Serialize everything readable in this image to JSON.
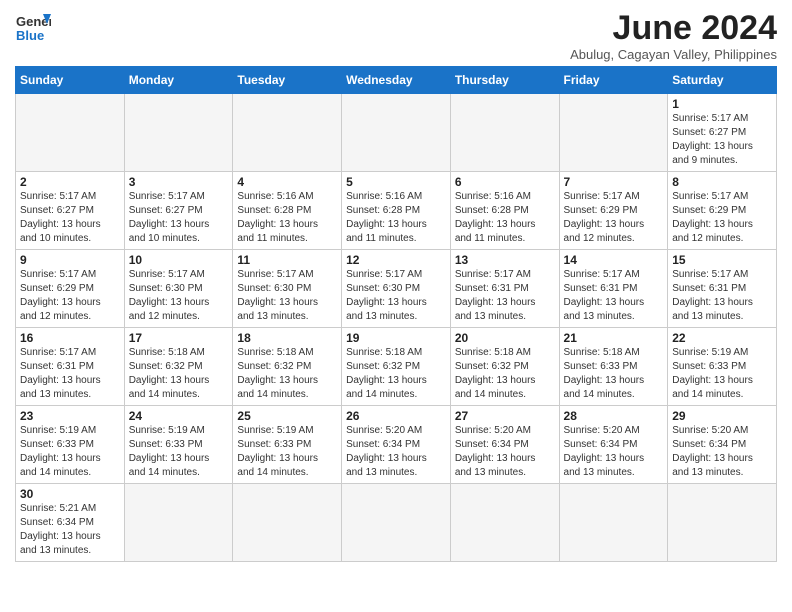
{
  "header": {
    "logo_line1": "General",
    "logo_line2": "Blue",
    "month_year": "June 2024",
    "location": "Abulug, Cagayan Valley, Philippines"
  },
  "weekdays": [
    "Sunday",
    "Monday",
    "Tuesday",
    "Wednesday",
    "Thursday",
    "Friday",
    "Saturday"
  ],
  "weeks": [
    [
      {
        "day": "",
        "info": ""
      },
      {
        "day": "",
        "info": ""
      },
      {
        "day": "",
        "info": ""
      },
      {
        "day": "",
        "info": ""
      },
      {
        "day": "",
        "info": ""
      },
      {
        "day": "",
        "info": ""
      },
      {
        "day": "1",
        "info": "Sunrise: 5:17 AM\nSunset: 6:27 PM\nDaylight: 13 hours\nand 9 minutes."
      }
    ],
    [
      {
        "day": "2",
        "info": "Sunrise: 5:17 AM\nSunset: 6:27 PM\nDaylight: 13 hours\nand 10 minutes."
      },
      {
        "day": "3",
        "info": "Sunrise: 5:17 AM\nSunset: 6:27 PM\nDaylight: 13 hours\nand 10 minutes."
      },
      {
        "day": "4",
        "info": "Sunrise: 5:16 AM\nSunset: 6:28 PM\nDaylight: 13 hours\nand 11 minutes."
      },
      {
        "day": "5",
        "info": "Sunrise: 5:16 AM\nSunset: 6:28 PM\nDaylight: 13 hours\nand 11 minutes."
      },
      {
        "day": "6",
        "info": "Sunrise: 5:16 AM\nSunset: 6:28 PM\nDaylight: 13 hours\nand 11 minutes."
      },
      {
        "day": "7",
        "info": "Sunrise: 5:17 AM\nSunset: 6:29 PM\nDaylight: 13 hours\nand 12 minutes."
      },
      {
        "day": "8",
        "info": "Sunrise: 5:17 AM\nSunset: 6:29 PM\nDaylight: 13 hours\nand 12 minutes."
      }
    ],
    [
      {
        "day": "9",
        "info": "Sunrise: 5:17 AM\nSunset: 6:29 PM\nDaylight: 13 hours\nand 12 minutes."
      },
      {
        "day": "10",
        "info": "Sunrise: 5:17 AM\nSunset: 6:30 PM\nDaylight: 13 hours\nand 12 minutes."
      },
      {
        "day": "11",
        "info": "Sunrise: 5:17 AM\nSunset: 6:30 PM\nDaylight: 13 hours\nand 13 minutes."
      },
      {
        "day": "12",
        "info": "Sunrise: 5:17 AM\nSunset: 6:30 PM\nDaylight: 13 hours\nand 13 minutes."
      },
      {
        "day": "13",
        "info": "Sunrise: 5:17 AM\nSunset: 6:31 PM\nDaylight: 13 hours\nand 13 minutes."
      },
      {
        "day": "14",
        "info": "Sunrise: 5:17 AM\nSunset: 6:31 PM\nDaylight: 13 hours\nand 13 minutes."
      },
      {
        "day": "15",
        "info": "Sunrise: 5:17 AM\nSunset: 6:31 PM\nDaylight: 13 hours\nand 13 minutes."
      }
    ],
    [
      {
        "day": "16",
        "info": "Sunrise: 5:17 AM\nSunset: 6:31 PM\nDaylight: 13 hours\nand 13 minutes."
      },
      {
        "day": "17",
        "info": "Sunrise: 5:18 AM\nSunset: 6:32 PM\nDaylight: 13 hours\nand 14 minutes."
      },
      {
        "day": "18",
        "info": "Sunrise: 5:18 AM\nSunset: 6:32 PM\nDaylight: 13 hours\nand 14 minutes."
      },
      {
        "day": "19",
        "info": "Sunrise: 5:18 AM\nSunset: 6:32 PM\nDaylight: 13 hours\nand 14 minutes."
      },
      {
        "day": "20",
        "info": "Sunrise: 5:18 AM\nSunset: 6:32 PM\nDaylight: 13 hours\nand 14 minutes."
      },
      {
        "day": "21",
        "info": "Sunrise: 5:18 AM\nSunset: 6:33 PM\nDaylight: 13 hours\nand 14 minutes."
      },
      {
        "day": "22",
        "info": "Sunrise: 5:19 AM\nSunset: 6:33 PM\nDaylight: 13 hours\nand 14 minutes."
      }
    ],
    [
      {
        "day": "23",
        "info": "Sunrise: 5:19 AM\nSunset: 6:33 PM\nDaylight: 13 hours\nand 14 minutes."
      },
      {
        "day": "24",
        "info": "Sunrise: 5:19 AM\nSunset: 6:33 PM\nDaylight: 13 hours\nand 14 minutes."
      },
      {
        "day": "25",
        "info": "Sunrise: 5:19 AM\nSunset: 6:33 PM\nDaylight: 13 hours\nand 14 minutes."
      },
      {
        "day": "26",
        "info": "Sunrise: 5:20 AM\nSunset: 6:34 PM\nDaylight: 13 hours\nand 13 minutes."
      },
      {
        "day": "27",
        "info": "Sunrise: 5:20 AM\nSunset: 6:34 PM\nDaylight: 13 hours\nand 13 minutes."
      },
      {
        "day": "28",
        "info": "Sunrise: 5:20 AM\nSunset: 6:34 PM\nDaylight: 13 hours\nand 13 minutes."
      },
      {
        "day": "29",
        "info": "Sunrise: 5:20 AM\nSunset: 6:34 PM\nDaylight: 13 hours\nand 13 minutes."
      }
    ],
    [
      {
        "day": "30",
        "info": "Sunrise: 5:21 AM\nSunset: 6:34 PM\nDaylight: 13 hours\nand 13 minutes."
      },
      {
        "day": "",
        "info": ""
      },
      {
        "day": "",
        "info": ""
      },
      {
        "day": "",
        "info": ""
      },
      {
        "day": "",
        "info": ""
      },
      {
        "day": "",
        "info": ""
      },
      {
        "day": "",
        "info": ""
      }
    ]
  ]
}
